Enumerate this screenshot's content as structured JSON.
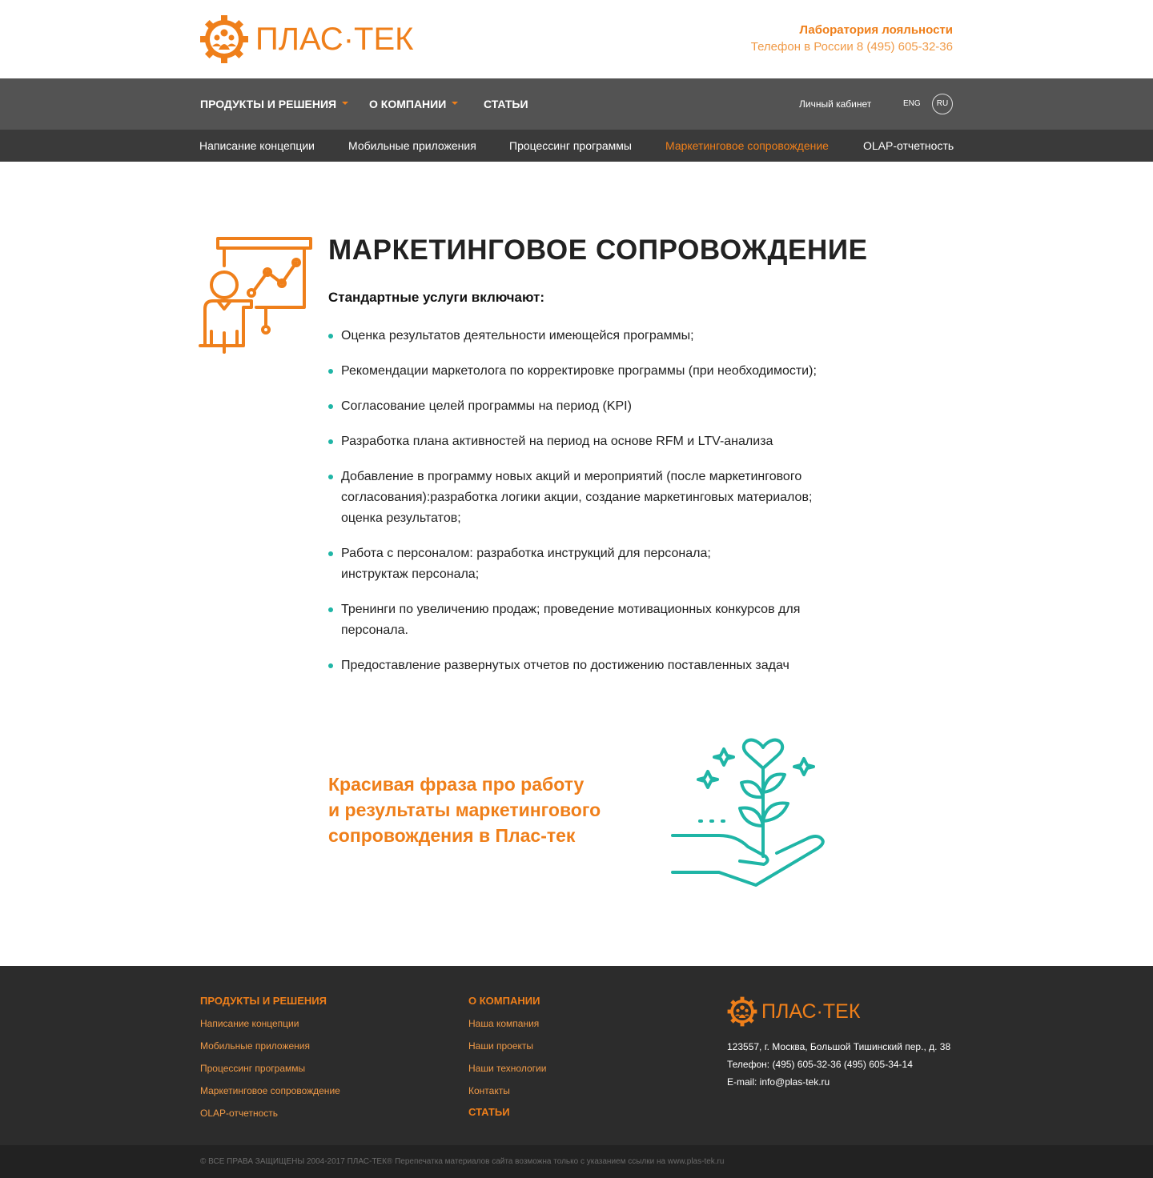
{
  "header": {
    "logo_text": "ПЛАС·ТЕК",
    "lab_title": "Лаборатория лояльности",
    "phone": "Телефон в России 8 (495) 605-32-36"
  },
  "nav": {
    "items": [
      {
        "label": "ПРОДУКТЫ И РЕШЕНИЯ",
        "has_dropdown": true
      },
      {
        "label": "О КОМПАНИИ",
        "has_dropdown": true
      },
      {
        "label": "СТАТЬИ",
        "has_dropdown": false
      }
    ],
    "cabinet": "Личный кабинет",
    "lang_eng": "ENG",
    "lang_ru": "RU"
  },
  "subnav": {
    "items": [
      "Написание концепции",
      "Мобильные приложения",
      "Процессинг программы",
      "Маркетинговое сопровождение",
      "OLAP-отчетность"
    ],
    "active": "Маркетинговое сопровождение"
  },
  "main": {
    "title": "МАРКЕТИНГОВОЕ СОПРОВОЖДЕНИЕ",
    "subtitle": "Стандартные услуги включают:",
    "services": [
      "Оценка результатов деятельности имеющейся программы;",
      "Рекомендации маркетолога по корректировке программы (при необходимости);",
      "Согласование целей программы на период (KPI)",
      "Разработка плана активностей на период на основе RFM и LTV-анализа",
      "Добавление в программу новых акций и мероприятий (после маркетингового согласования):разработка логики акции, создание маркетинговых материалов; оценка результатов;",
      "Работа с персоналом: разработка инструкций для персонала; инструктаж персонала;",
      "Тренинги по увеличению продаж; проведение мотивационных конкурсов для персонала.",
      "Предоставление развернутых отчетов по достижению поставленных задач"
    ],
    "phrase_lines": [
      "Красивая фраза про работу",
      "и результаты маркетингового",
      "сопровождения в Плас-тек"
    ]
  },
  "footer": {
    "products": {
      "heading": "ПРОДУКТЫ И РЕШЕНИЯ",
      "links": [
        "Написание концепции",
        "Мобильные приложения",
        "Процессинг программы",
        "Маркетинговое сопровождение",
        "OLAP-отчетность"
      ]
    },
    "company": {
      "heading": "О КОМПАНИИ",
      "links": [
        "Наша компания",
        "Наши проекты",
        "Наши технологии",
        "Контакты"
      ],
      "articles_heading": "СТАТЬИ"
    },
    "logo_text": "ПЛАС·ТЕК",
    "address": "123557, г. Москва, Большой Тишинский пер., д. 38",
    "phones": "Телефон: (495) 605-32-36 (495) 605-34-14",
    "email": "E-mail: info@plas-tek.ru",
    "copyright": "© ВСЕ ПРАВА ЗАЩИЩЕНЫ 2004-2017 ПЛАС-ТЕК®  Перепечатка материалов сайта возможна только с указанием ссылки на www.plas-tek.ru"
  },
  "colors": {
    "accent": "#ef7f1a",
    "teal": "#1fb5a6",
    "nav_bg": "#535353",
    "subnav_bg": "#3a3a3a",
    "footer_bg": "#2c2c2c"
  },
  "icons": [
    "logo-gear-icon",
    "presentation-icon",
    "plant-hand-icon",
    "chevron-down-icon"
  ]
}
